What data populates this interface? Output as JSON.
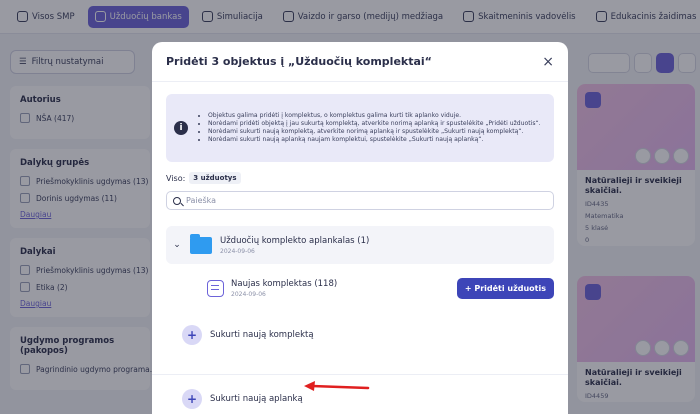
{
  "tabs": [
    {
      "label": "Visos SMP",
      "icon": "grid-icon",
      "active": false
    },
    {
      "label": "Užduočių bankas",
      "icon": "task-bank-icon",
      "active": true
    },
    {
      "label": "Simuliacija",
      "icon": "simulation-icon",
      "active": false
    },
    {
      "label": "Vaizdo ir garso (medijų) medžiaga",
      "icon": "media-icon",
      "active": false
    },
    {
      "label": "Skaitmeninis vadovėlis",
      "icon": "textbook-icon",
      "active": false
    },
    {
      "label": "Edukacinis žaidimas",
      "icon": "game-icon",
      "active": false
    }
  ],
  "filters_button": "Filtrų nustatymai",
  "left_panel": {
    "groups": [
      {
        "title": "Autorius",
        "items": [
          "NŠA (417)"
        ],
        "more": ""
      },
      {
        "title": "Dalykų grupės",
        "items": [
          "Priešmokyklinis ugdymas (13)",
          "Dorinis ugdymas (11)"
        ],
        "more": "Daugiau"
      },
      {
        "title": "Dalykai",
        "items": [
          "Priešmokyklinis ugdymas (13)",
          "Etika (2)"
        ],
        "more": "Daugiau"
      },
      {
        "title": "Ugdymo programos (pakopos)",
        "items": [
          "Pagrindinio ugdymo programa..."
        ],
        "more": ""
      }
    ]
  },
  "cards": [
    {
      "title": "Natūralieji ir sveikieji skaičiai.",
      "id": "ID4435",
      "subject": "Matematika",
      "grade": "5 klasė",
      "stars": "0"
    },
    {
      "title": "Natūralieji ir sveikieji skaičiai.",
      "id": "ID4459",
      "subject": "",
      "grade": "",
      "stars": ""
    }
  ],
  "modal": {
    "title": "Pridėti 3 objektus į „Užduočių komplektai“",
    "close": "×",
    "info": [
      "Objektus galima pridėti į komplektus, o komplektus galima kurti tik aplanko viduje.",
      "Norėdami pridėti objektą į jau sukurtą komplektą, atverkite norimą aplanką ir spustelėkite „Pridėti užduotis“.",
      "Norėdami sukurti naują komplektą, atverkite norimą aplanką ir spustelėkite „Sukurti naują komplektą“.",
      "Norėdami sukurti naują aplanką naujam komplektui, spustelėkite „Sukurti naują aplanką“."
    ],
    "count_label": "Viso:",
    "count_value": "3 užduotys",
    "search_placeholder": "Paieška",
    "folder": {
      "name": "Užduočių komplekto aplankalas (1)",
      "date": "2024-09-06"
    },
    "set": {
      "name": "Naujas komplektas (118)",
      "date": "2024-09-06"
    },
    "add_button": "+ Pridėti užduotis",
    "create_set": "Sukurti naują komplektą",
    "create_folder": "Sukurti naują aplanką",
    "plus": "+"
  },
  "colors": {
    "accent": "#6c63d9",
    "primary_button": "#3d45b8",
    "folder": "#2f9bf0",
    "arrow": "#e02020"
  }
}
